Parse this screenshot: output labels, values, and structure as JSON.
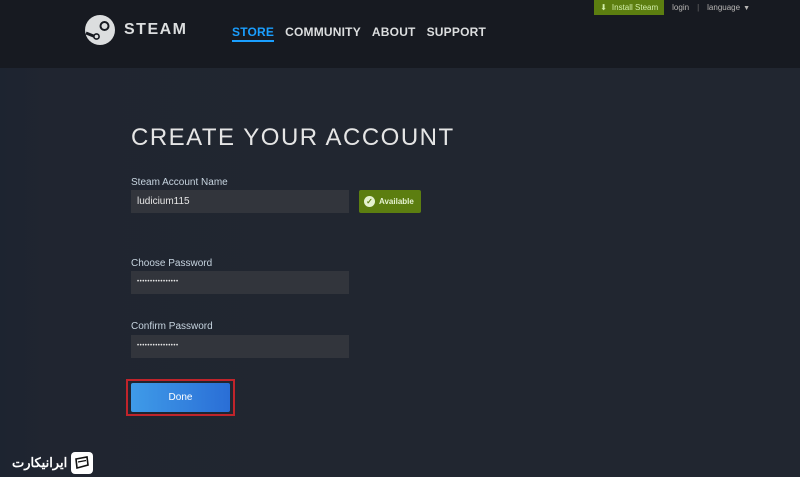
{
  "topbar": {
    "install_label": "Install Steam",
    "login_label": "login",
    "separator": "|",
    "language_label": "language"
  },
  "header": {
    "logo_text": "STEAM",
    "nav": [
      "STORE",
      "COMMUNITY",
      "ABOUT",
      "SUPPORT"
    ],
    "active_nav": "STORE"
  },
  "form": {
    "title": "CREATE YOUR ACCOUNT",
    "account_name_label": "Steam Account Name",
    "account_name_value": "ludicium115",
    "available_label": "Available",
    "choose_password_label": "Choose Password",
    "choose_password_value": "••••••••••••••••",
    "confirm_password_label": "Confirm Password",
    "confirm_password_value": "••••••••••••••••",
    "done_label": "Done"
  },
  "watermark": {
    "text": "ایرانیکارت"
  },
  "colors": {
    "header_bg": "#171a21",
    "page_bg": "#212630",
    "accent_blue": "#1a9fff",
    "install_green": "#5c7e10",
    "highlight_red": "#c0242b"
  }
}
